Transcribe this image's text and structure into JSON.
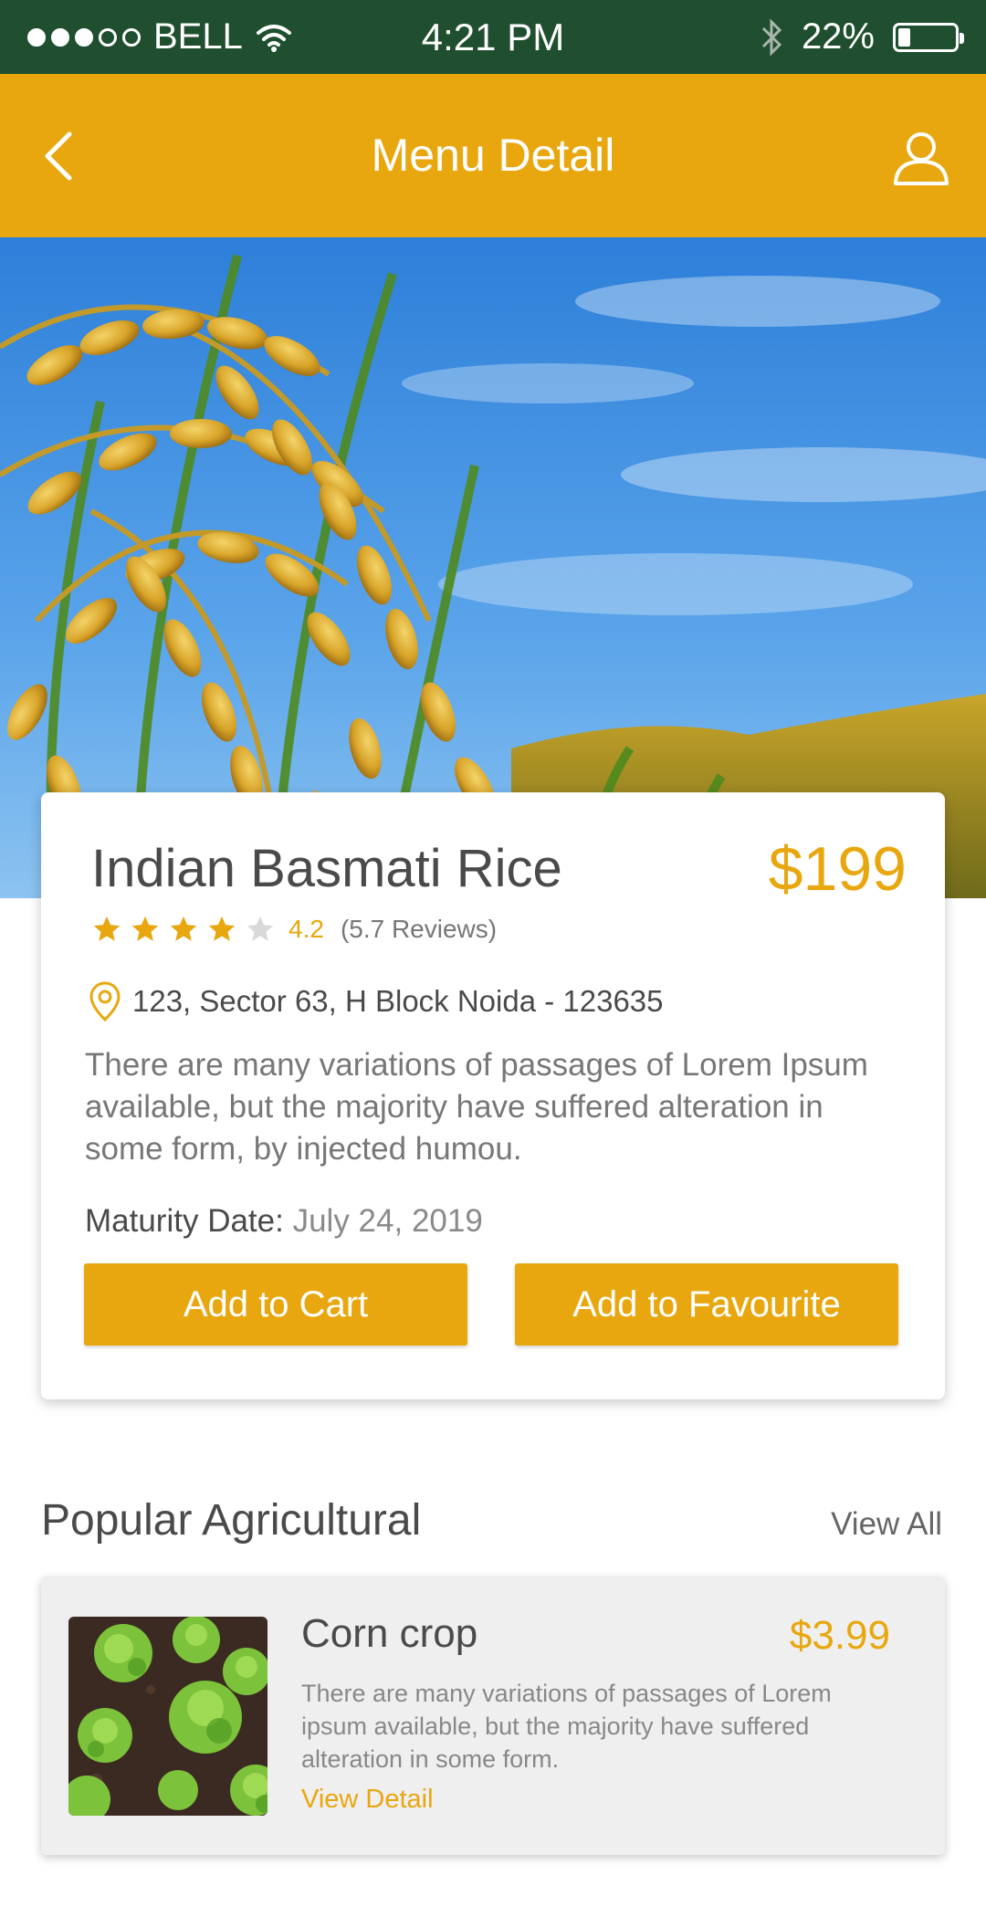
{
  "status_bar": {
    "carrier": "BELL",
    "time": "4:21 PM",
    "battery": "22%",
    "battery_level": 0.22,
    "signal_bars_filled": 3,
    "signal_bars_total": 5
  },
  "header": {
    "title": "Menu Detail",
    "back_icon": "chevron-left-icon",
    "profile_icon": "user-icon"
  },
  "colors": {
    "accent": "#e8a70e",
    "status_bar": "#1f4f2f",
    "text": "#4a4a4a"
  },
  "product": {
    "name": "Indian Basmati Rice",
    "price": "$199",
    "rating": "4.2",
    "rating_stars_filled": 4,
    "rating_stars_total": 5,
    "reviews": "(5.7 Reviews)",
    "location": "123, Sector 63, H Block Noida - 123635",
    "description": "There are many variations of passages of Lorem Ipsum available, but the majority have suffered alteration in some form, by injected humou.",
    "maturity_label": "Maturity Date:",
    "maturity_value": "July 24, 2019",
    "add_to_cart": "Add to Cart",
    "add_to_favourite": "Add to Favourite"
  },
  "popular": {
    "title": "Popular Agricultural",
    "view_all": "View All",
    "items": [
      {
        "name": "Corn crop",
        "price": "$3.99",
        "description": "There are many variations of passages of Lorem ipsum available, but the majority have suffered alteration in some form.",
        "link": "View Detail"
      }
    ]
  }
}
